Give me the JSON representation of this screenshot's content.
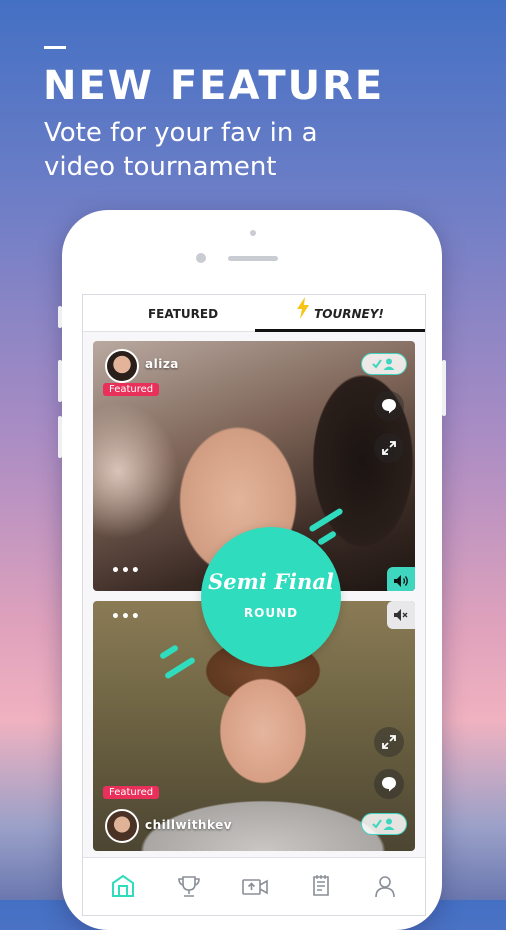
{
  "promo": {
    "headline": "NEW FEATURE",
    "subheadline": "Vote for your fav in a video tournament"
  },
  "tabs": [
    {
      "label": "FEATURED",
      "active": false
    },
    {
      "label": "TOURNEY!",
      "active": true,
      "icon": "lightning-bolt-icon"
    }
  ],
  "videos": [
    {
      "username": "aliza",
      "badge": "Featured",
      "controls": [
        "follow-icon",
        "comment-icon",
        "expand-icon",
        "more-dots-icon",
        "sound-on-icon"
      ]
    },
    {
      "username": "chillwithkev",
      "badge": "Featured",
      "controls": [
        "sound-off-icon",
        "more-dots-icon",
        "expand-icon",
        "comment-icon",
        "follow-icon"
      ]
    }
  ],
  "round": {
    "title": "Semi Final",
    "subtitle": "ROUND"
  },
  "bottom_nav": [
    {
      "name": "home-icon",
      "active": true
    },
    {
      "name": "trophy-icon",
      "active": false
    },
    {
      "name": "upload-video-icon",
      "active": false
    },
    {
      "name": "notes-icon",
      "active": false
    },
    {
      "name": "profile-icon",
      "active": false
    }
  ],
  "colors": {
    "accent": "#2fdcbd",
    "badge": "#e8305a",
    "bolt": "#f5c518"
  }
}
